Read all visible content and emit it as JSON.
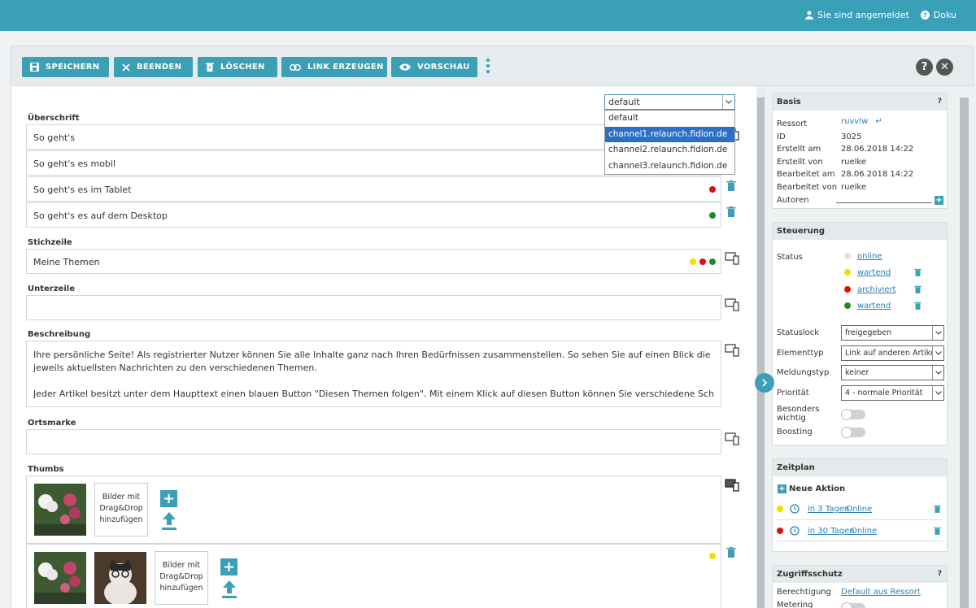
{
  "topbar": {
    "login": "Sie sind angemeldet",
    "doku": "Doku"
  },
  "toolbar": {
    "save": "SPEICHERN",
    "end": "BEENDEN",
    "delete": "LÖSCHEN",
    "link": "LINK ERZEUGEN",
    "preview": "VORSCHAU",
    "help": "?",
    "close": "✕"
  },
  "channel_select": {
    "value": "default",
    "options": [
      "default",
      "channel1.relaunch.fidion.de",
      "channel2.relaunch.fidion.de",
      "channel3.relaunch.fidion.de"
    ],
    "highlighted": 1
  },
  "fields": {
    "ueberschrift_label": "Überschrift",
    "ueberschrift": [
      "So geht's",
      "So geht's es mobil",
      "So geht's es im Tablet",
      "So geht's es auf dem Desktop"
    ],
    "stichzeile_label": "Stichzeile",
    "stichzeile": "Meine Themen",
    "unterzeile_label": "Unterzeile",
    "unterzeile": "",
    "beschreibung_label": "Beschreibung",
    "beschreibung_p1": "Ihre persönliche Seite! Als registrierter Nutzer können Sie alle Inhalte ganz nach Ihren Bedürfnissen zusammenstellen. So sehen Sie auf einen Blick die jeweils aktuellsten Nachrichten zu den verschiedenen Themen.",
    "beschreibung_p2": "Jeder Artikel besitzt unter dem Haupttext einen blauen Button \"Diesen Themen folgen\". Mit einem Klick auf diesen Button können Sie verschiedene Schlagworte, Orte",
    "ortsmarke_label": "Ortsmarke",
    "ortsmarke": "",
    "thumbs_label": "Thumbs",
    "drop_text": "Bilder mit Drag&Drop hinzufügen"
  },
  "basis": {
    "title": "Basis",
    "help": "?",
    "ressort_label": "Ressort",
    "ressort": "ruvvlw",
    "id_label": "ID",
    "id": "3025",
    "erstellt_am_label": "Erstellt am",
    "erstellt_am": "28.06.2018 14:22",
    "erstellt_von_label": "Erstellt von",
    "erstellt_von": "ruelke",
    "bearbeitet_am_label": "Bearbeitet am",
    "bearbeitet_am": "28.06.2018 14:22",
    "bearbeitet_von_label": "Bearbeitet von",
    "bearbeitet_von": "ruelke",
    "autoren_label": "Autoren"
  },
  "steuerung": {
    "title": "Steuerung",
    "status_label": "Status",
    "status": [
      "online",
      "wartend",
      "archiviert",
      "wartend"
    ],
    "statuslock_label": "Statuslock",
    "statuslock": "freigegeben",
    "elementtyp_label": "Elementtyp",
    "elementtyp": "Link auf anderen Artikel",
    "meldungstyp_label": "Meldungstyp",
    "meldungstyp": "keiner",
    "prioritaet_label": "Priorität",
    "prioritaet": "4 - normale Priorität",
    "besonders_label": "Besonders wichtig",
    "boosting_label": "Boosting"
  },
  "zeitplan": {
    "title": "Zeitplan",
    "neue_aktion": "Neue Aktion",
    "items": [
      {
        "when": "in 3 Tagen",
        "what": "Online"
      },
      {
        "when": "in 30 Tagen",
        "what": "Online"
      }
    ]
  },
  "zugriff": {
    "title": "Zugriffsschutz",
    "help": "?",
    "berechtigung_label": "Berechtigung",
    "berechtigung": "Default aus Ressort",
    "metering_label": "Metering"
  },
  "colors": {
    "accent": "#3b9fb6",
    "topbar": "#3aa0b8",
    "yellow": "#f0e000",
    "red": "#e01010",
    "green": "#1b8a2a"
  }
}
